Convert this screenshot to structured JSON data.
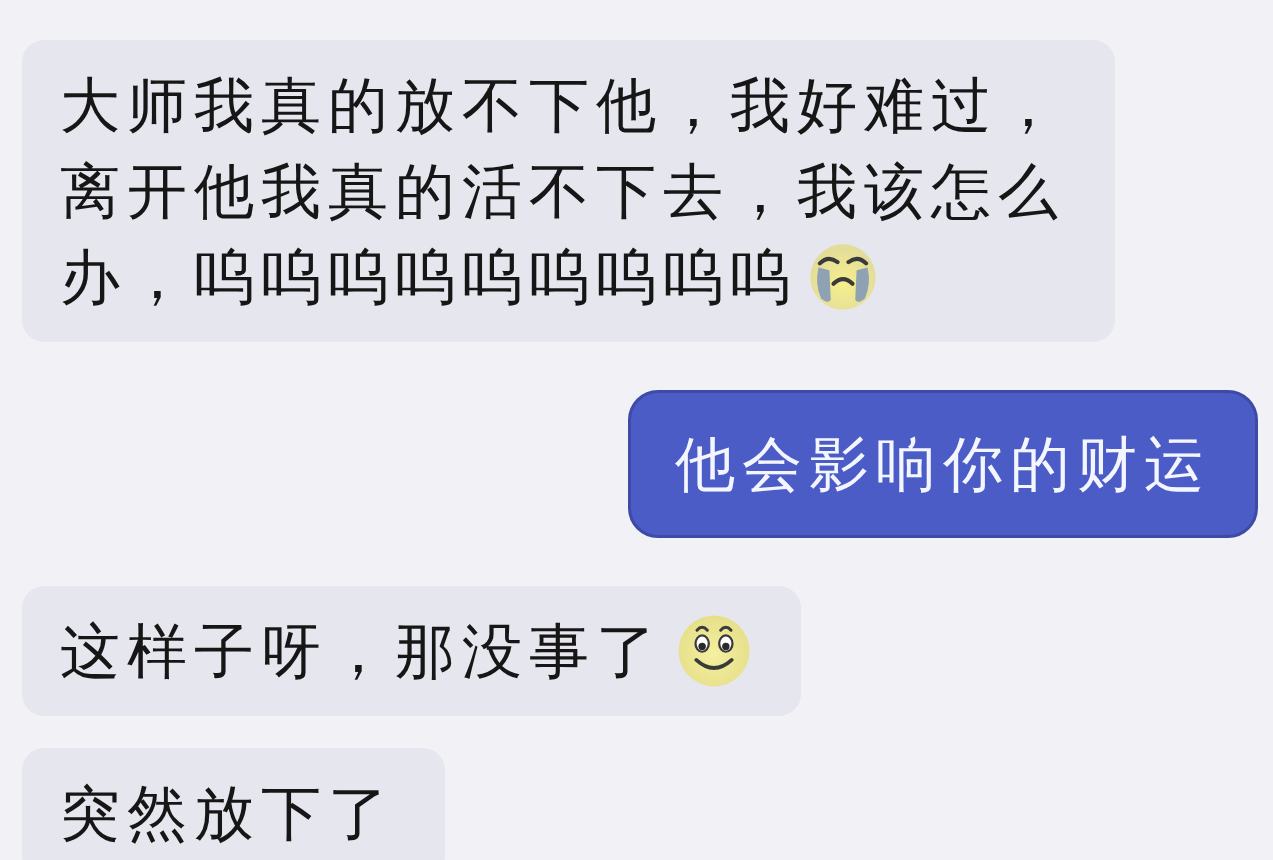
{
  "messages": [
    {
      "kind": "incoming",
      "lines": [
        "大师我真的放不下他，我好难过，",
        "离开他我真的活不下去，我该怎么",
        "办，呜呜呜呜呜呜呜呜呜"
      ],
      "emoji": {
        "kind": "crying"
      }
    },
    {
      "kind": "outgoing",
      "lines": [
        "他会影响你的财运"
      ]
    },
    {
      "kind": "incoming",
      "lines": [
        "这样子呀，那没事了"
      ],
      "emoji": {
        "kind": "smiling"
      }
    },
    {
      "kind": "incoming",
      "lines": [
        "突然放下了"
      ]
    }
  ]
}
